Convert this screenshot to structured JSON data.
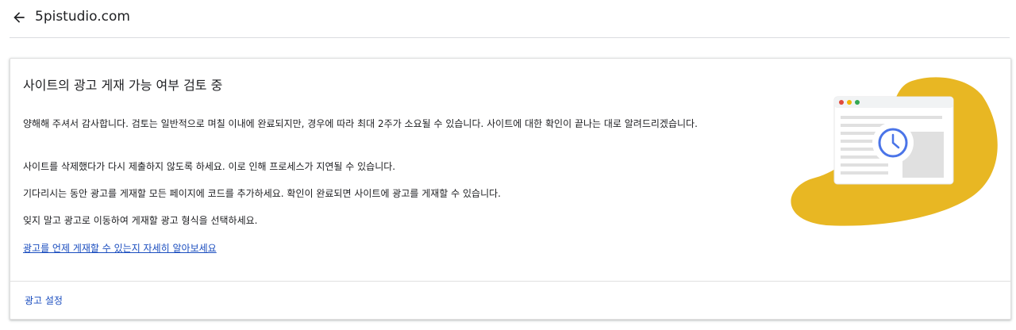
{
  "header": {
    "site_name": "5pistudio.com",
    "back_icon": "arrow-back-icon"
  },
  "card": {
    "title": "사이트의 광고 게재 가능 여부 검토 중",
    "paragraphs": [
      "양해해 주셔서 감사합니다. 검토는 일반적으로 며칠 이내에 완료되지만, 경우에 따라 최대 2주가 소요될 수 있습니다. 사이트에 대한 확인이 끝나는 대로 알려드리겠습니다.",
      "사이트를 삭제했다가 다시 제출하지 않도록 하세요. 이로 인해 프로세스가 지연될 수 있습니다.",
      "기다리시는 동안 광고를 게재할 모든 페이지에 코드를 추가하세요. 확인이 완료되면 사이트에 광고를 게재할 수 있습니다.",
      "잊지 말고 광고로 이동하여 게재할 광고 형식을 선택하세요."
    ],
    "learn_more_link": "광고를 언제 게재할 수 있는지 자세히 알아보세요",
    "ad_settings_button": "광고 설정",
    "illustration_icon": "browser-clock-icon"
  },
  "colors": {
    "link": "#1a4dbf",
    "blob": "#e8b723",
    "clock": "#4a74e8",
    "dot_red": "#e04a3b",
    "dot_yellow": "#f2b600",
    "dot_green": "#34a853"
  }
}
